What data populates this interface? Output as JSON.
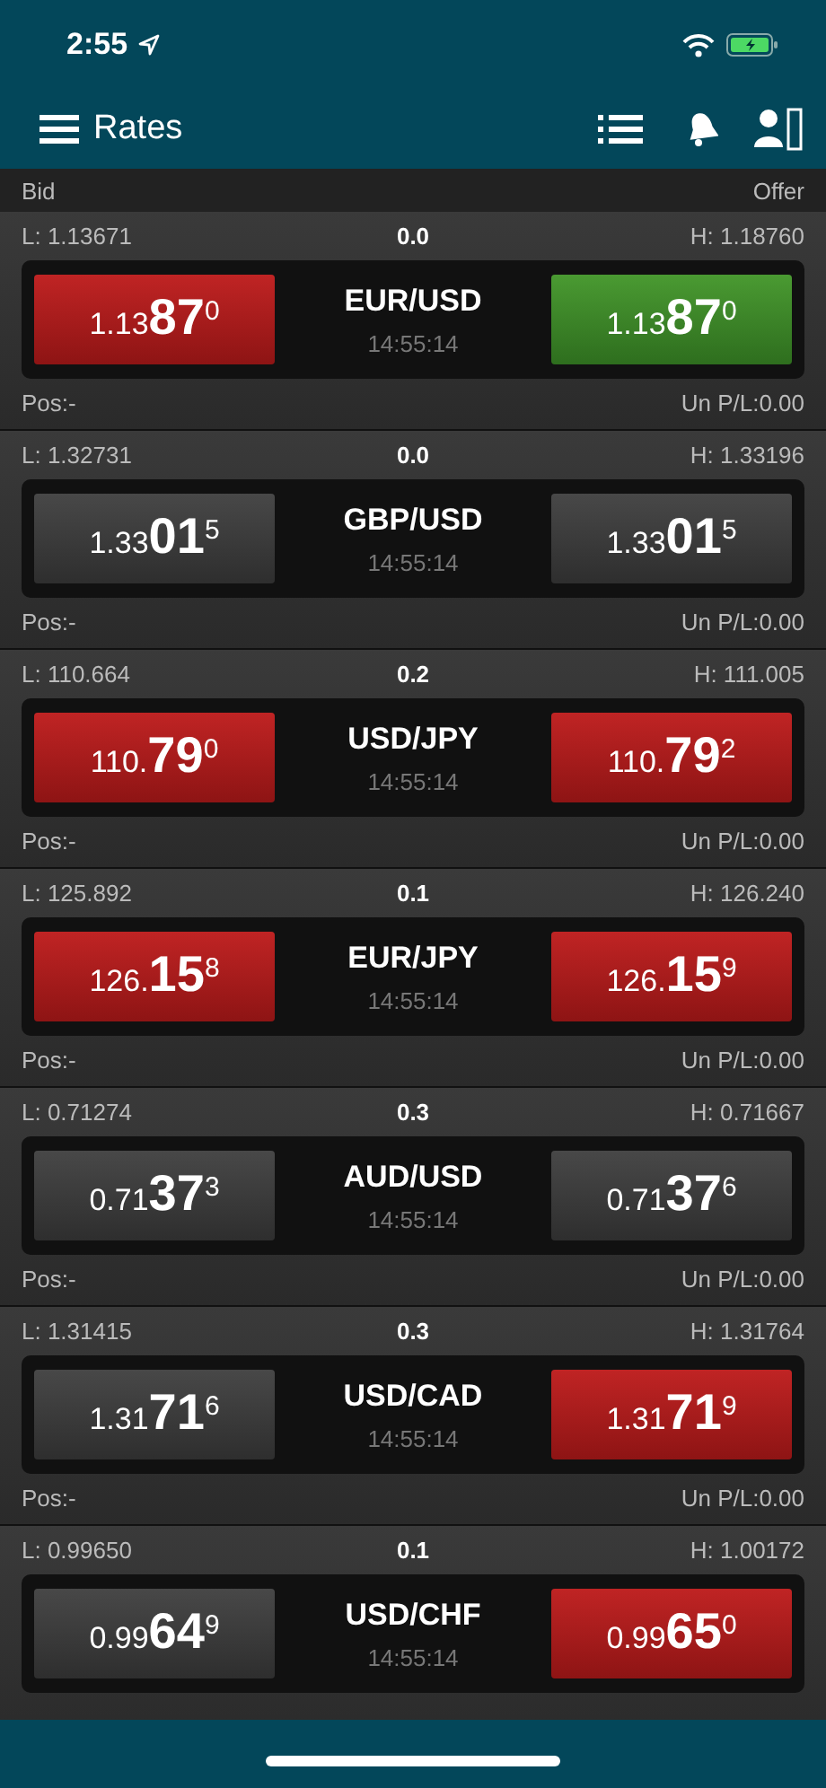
{
  "status_bar": {
    "time": "2:55"
  },
  "nav": {
    "title": "Rates"
  },
  "header": {
    "left": "Bid",
    "right": "Offer"
  },
  "rows": [
    {
      "low": "L: 1.13671",
      "spread": "0.0",
      "high": "H: 1.18760",
      "pair": "EUR/USD",
      "time": "14:55:14",
      "bid": {
        "prefix": "1.13",
        "big": "87",
        "pip": "0",
        "kind": "down"
      },
      "offer": {
        "prefix": "1.13",
        "big": "87",
        "pip": "0",
        "kind": "up"
      },
      "pos": "Pos:-",
      "pl": "Un P/L:0.00"
    },
    {
      "low": "L: 1.32731",
      "spread": "0.0",
      "high": "H: 1.33196",
      "pair": "GBP/USD",
      "time": "14:55:14",
      "bid": {
        "prefix": "1.33",
        "big": "01",
        "pip": "5",
        "kind": "flat"
      },
      "offer": {
        "prefix": "1.33",
        "big": "01",
        "pip": "5",
        "kind": "flat"
      },
      "pos": "Pos:-",
      "pl": "Un P/L:0.00"
    },
    {
      "low": "L: 110.664",
      "spread": "0.2",
      "high": "H: 111.005",
      "pair": "USD/JPY",
      "time": "14:55:14",
      "bid": {
        "prefix": "110.",
        "big": "79",
        "pip": "0",
        "kind": "down"
      },
      "offer": {
        "prefix": "110.",
        "big": "79",
        "pip": "2",
        "kind": "down"
      },
      "pos": "Pos:-",
      "pl": "Un P/L:0.00"
    },
    {
      "low": "L: 125.892",
      "spread": "0.1",
      "high": "H: 126.240",
      "pair": "EUR/JPY",
      "time": "14:55:14",
      "bid": {
        "prefix": "126.",
        "big": "15",
        "pip": "8",
        "kind": "down"
      },
      "offer": {
        "prefix": "126.",
        "big": "15",
        "pip": "9",
        "kind": "down"
      },
      "pos": "Pos:-",
      "pl": "Un P/L:0.00"
    },
    {
      "low": "L: 0.71274",
      "spread": "0.3",
      "high": "H: 0.71667",
      "pair": "AUD/USD",
      "time": "14:55:14",
      "bid": {
        "prefix": "0.71",
        "big": "37",
        "pip": "3",
        "kind": "flat"
      },
      "offer": {
        "prefix": "0.71",
        "big": "37",
        "pip": "6",
        "kind": "flat"
      },
      "pos": "Pos:-",
      "pl": "Un P/L:0.00"
    },
    {
      "low": "L: 1.31415",
      "spread": "0.3",
      "high": "H: 1.31764",
      "pair": "USD/CAD",
      "time": "14:55:14",
      "bid": {
        "prefix": "1.31",
        "big": "71",
        "pip": "6",
        "kind": "flat"
      },
      "offer": {
        "prefix": "1.31",
        "big": "71",
        "pip": "9",
        "kind": "down"
      },
      "pos": "Pos:-",
      "pl": "Un P/L:0.00"
    },
    {
      "low": "L: 0.99650",
      "spread": "0.1",
      "high": "H: 1.00172",
      "pair": "USD/CHF",
      "time": "14:55:14",
      "bid": {
        "prefix": "0.99",
        "big": "64",
        "pip": "9",
        "kind": "flat"
      },
      "offer": {
        "prefix": "0.99",
        "big": "65",
        "pip": "0",
        "kind": "down"
      }
    }
  ]
}
